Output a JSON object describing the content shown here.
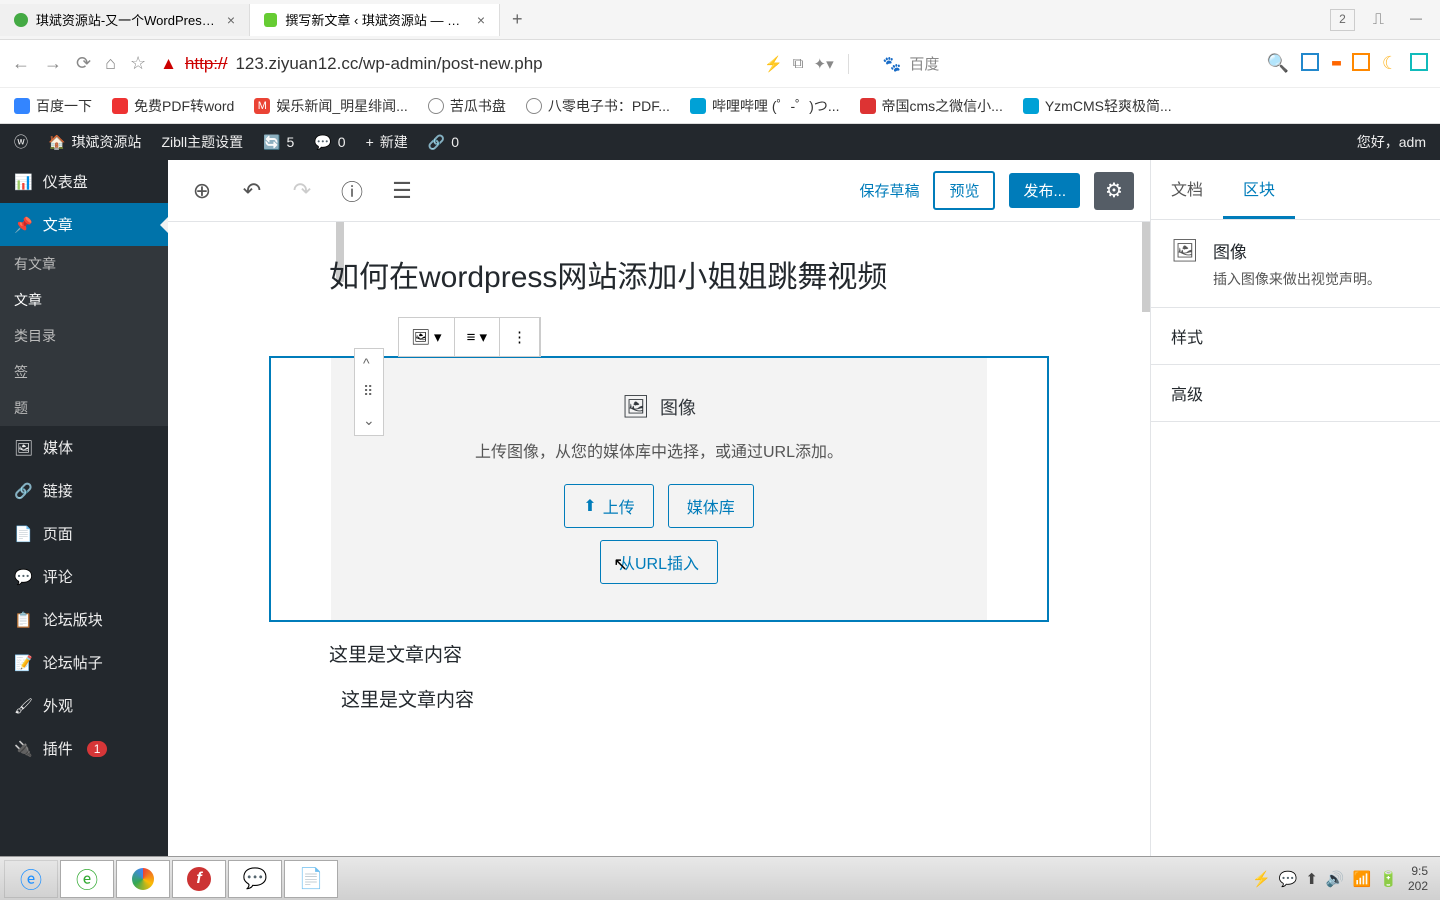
{
  "browser": {
    "tabs": [
      {
        "title": "琪斌资源站-又一个WordPress站",
        "active": false
      },
      {
        "title": "撰写新文章 ‹ 琪斌资源站 — Wo...",
        "active": true
      }
    ],
    "tab_count": "2",
    "url_prefix": "http://",
    "url": "123.ziyuan12.cc/wp-admin/post-new.php",
    "search_placeholder": "百度",
    "bookmarks": [
      {
        "label": "百度一下"
      },
      {
        "label": "免费PDF转word"
      },
      {
        "label": "娱乐新闻_明星绯闻..."
      },
      {
        "label": "苦瓜书盘"
      },
      {
        "label": "八零电子书：PDF..."
      },
      {
        "label": "哔哩哔哩 (゜-゜)つ..."
      },
      {
        "label": "帝国cms之微信小..."
      },
      {
        "label": "YzmCMS轻爽极简..."
      }
    ]
  },
  "adminbar": {
    "site": "琪斌资源站",
    "theme": "Zibll主题设置",
    "updates": "5",
    "comments": "0",
    "new": "新建",
    "links": "0",
    "greeting": "您好，adm"
  },
  "sidebar": {
    "items": [
      {
        "label": "仪表盘"
      },
      {
        "label": "文章",
        "current": true
      },
      {
        "label": "媒体"
      },
      {
        "label": "链接"
      },
      {
        "label": "页面"
      },
      {
        "label": "评论"
      },
      {
        "label": "论坛版块"
      },
      {
        "label": "论坛帖子"
      },
      {
        "label": "外观"
      },
      {
        "label": "插件",
        "badge": "1"
      }
    ],
    "submenu": [
      "有文章",
      "文章",
      "类目录",
      "签",
      "题"
    ]
  },
  "editor": {
    "toolbar": {
      "save_draft": "保存草稿",
      "preview": "预览",
      "publish": "发布..."
    },
    "post_title": "如何在wordpress网站添加小姐姐跳舞视频",
    "image_block": {
      "label": "图像",
      "desc": "上传图像，从您的媒体库中选择，或通过URL添加。",
      "upload": "上传",
      "media_lib": "媒体库",
      "from_url": "从URL插入"
    },
    "paragraphs": [
      "这里是文章内容",
      "这里是文章内容"
    ]
  },
  "right_sidebar": {
    "tab_doc": "文档",
    "tab_block": "区块",
    "block_title": "图像",
    "block_desc": "插入图像来做出视觉声明。",
    "sections": [
      "样式",
      "高级"
    ]
  },
  "taskbar": {
    "time": "9:5",
    "date": "202"
  }
}
